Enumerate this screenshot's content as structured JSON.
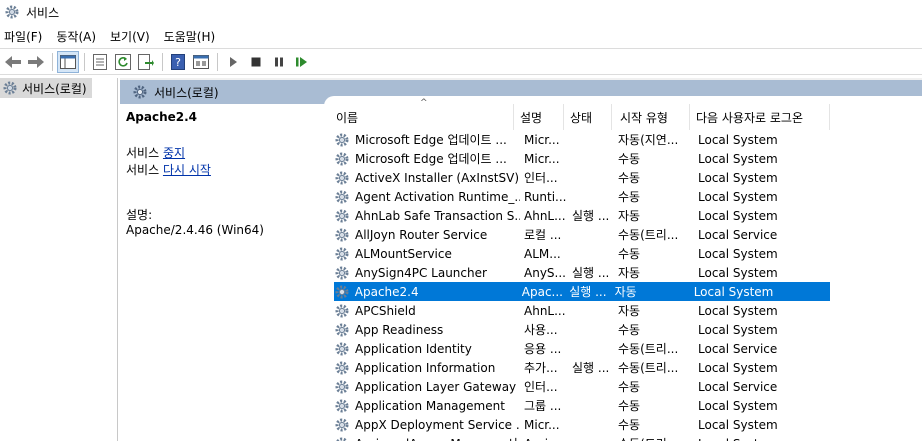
{
  "window": {
    "title": "서비스"
  },
  "menu": [
    {
      "label": "파일(F)",
      "name": "menu-file"
    },
    {
      "label": "동작(A)",
      "name": "menu-action"
    },
    {
      "label": "보기(V)",
      "name": "menu-view"
    },
    {
      "label": "도움말(H)",
      "name": "menu-help"
    }
  ],
  "tree": {
    "item": "서비스(로컬)"
  },
  "panel": {
    "header": "서비스(로컬)"
  },
  "details": {
    "service_name": "Apache2.4",
    "action_prefix": "서비스",
    "stop_link": "중지",
    "restart_link": "다시 시작",
    "desc_label": "설명:",
    "desc_text": "Apache/2.4.46 (Win64)"
  },
  "columns": [
    "이름",
    "설명",
    "상태",
    "시작 유형",
    "다음 사용자로 로그온"
  ],
  "rows": [
    {
      "name": "Microsoft Edge 업데이트 ...",
      "desc": "Micr...",
      "status": "",
      "startup": "자동(지연...",
      "logon": "Local System"
    },
    {
      "name": "Microsoft Edge 업데이트 ...",
      "desc": "Micr...",
      "status": "",
      "startup": "수동",
      "logon": "Local System"
    },
    {
      "name": "ActiveX Installer (AxInstSV)",
      "desc": "인터...",
      "status": "",
      "startup": "수동",
      "logon": "Local System"
    },
    {
      "name": "Agent Activation Runtime_...",
      "desc": "Runti...",
      "status": "",
      "startup": "수동",
      "logon": "Local System"
    },
    {
      "name": "AhnLab Safe Transaction S...",
      "desc": "AhnL...",
      "status": "실행 ...",
      "startup": "자동",
      "logon": "Local System"
    },
    {
      "name": "AllJoyn Router Service",
      "desc": "로컬 ...",
      "status": "",
      "startup": "수동(트리...",
      "logon": "Local Service"
    },
    {
      "name": "ALMountService",
      "desc": "ALM...",
      "status": "",
      "startup": "수동",
      "logon": "Local System"
    },
    {
      "name": "AnySign4PC Launcher",
      "desc": "AnyS...",
      "status": "실행 ...",
      "startup": "자동",
      "logon": "Local System"
    },
    {
      "name": "Apache2.4",
      "desc": "Apac...",
      "status": "실행 ...",
      "startup": "자동",
      "logon": "Local System",
      "selected": true
    },
    {
      "name": "APCShield",
      "desc": "AhnL...",
      "status": "",
      "startup": "자동",
      "logon": "Local System"
    },
    {
      "name": "App Readiness",
      "desc": "사용...",
      "status": "",
      "startup": "수동",
      "logon": "Local System"
    },
    {
      "name": "Application Identity",
      "desc": "응용 ...",
      "status": "",
      "startup": "수동(트리...",
      "logon": "Local Service"
    },
    {
      "name": "Application Information",
      "desc": "추가...",
      "status": "실행 ...",
      "startup": "수동(트리...",
      "logon": "Local System"
    },
    {
      "name": "Application Layer Gateway ...",
      "desc": "인터...",
      "status": "",
      "startup": "수동",
      "logon": "Local Service"
    },
    {
      "name": "Application Management",
      "desc": "그룹 ...",
      "status": "",
      "startup": "수동",
      "logon": "Local System"
    },
    {
      "name": "AppX Deployment Service ...",
      "desc": "Micr...",
      "status": "",
      "startup": "수동",
      "logon": "Local System"
    },
    {
      "name": "AssignedAccessManager 서...",
      "desc": "Assig...",
      "status": "",
      "startup": "수동(트리...",
      "logon": "Local System"
    }
  ],
  "colors": {
    "selection": "#0078d7",
    "header_band": "#a9bcd3",
    "link": "#0033aa"
  },
  "icons": [
    "gear-icon",
    "back-icon",
    "forward-icon",
    "show-hide-tree-icon",
    "properties-icon",
    "refresh-icon",
    "export-icon",
    "help-icon",
    "view-icon",
    "play-icon",
    "stop-icon",
    "pause-icon",
    "resume-icon"
  ]
}
